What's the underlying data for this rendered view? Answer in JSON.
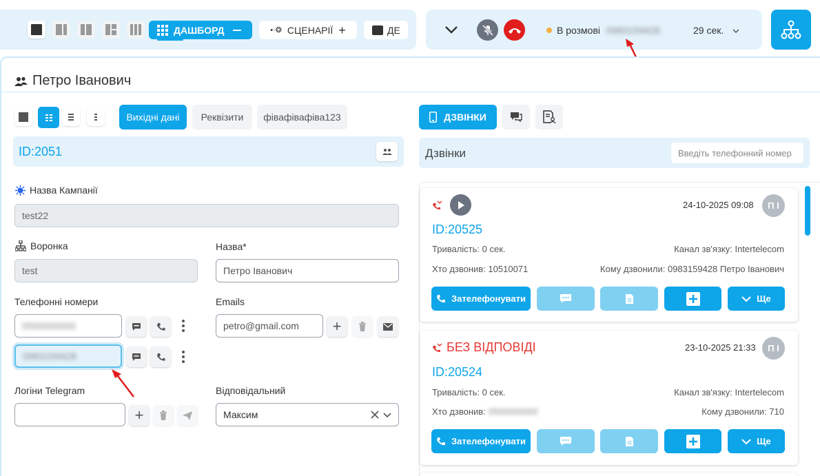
{
  "topbar": {
    "dashboard_label": "ДАШБОРД",
    "scenarios_label": "СЦЕНАРІЇ",
    "third_label": "ДЕ",
    "call_status": "В розмові",
    "call_number": "0983159428",
    "call_timer": "29 сек."
  },
  "contact": {
    "name": "Петро Іванович"
  },
  "left_tabs": {
    "tab1": "Вихідні дані",
    "tab2": "Реквізити",
    "tab3": "фівафівафіва123"
  },
  "form": {
    "id_label": "ID:2051",
    "campaign_label": "Назва Кампанії",
    "campaign_value": "test22",
    "funnel_label": "Воронка",
    "funnel_value": "test",
    "name_label": "Назва*",
    "name_value": "Петро Іванович",
    "phones_label": "Телефонні номери",
    "phone1": "0500000000",
    "phone2": "0983159428",
    "emails_label": "Emails",
    "email1": "petro@gmail.com",
    "telegram_label": "Логіни Telegram",
    "telegram_value": "",
    "responsible_label": "Відповідальний",
    "responsible_value": "Максим"
  },
  "right_tabs": {
    "calls_label": "ДЗВІНКИ"
  },
  "calls_panel": {
    "title": "Дзвінки",
    "search_placeholder": "Введіть телефонний номер"
  },
  "calls": [
    {
      "status": "",
      "datetime": "24-10-2025 09:08",
      "avatar": "П І",
      "id": "ID:20525",
      "duration": "Тривалість: 0 сек.",
      "channel": "Канал зв'язку: Intertelecom",
      "caller": "Хто дзвонив: 10510071",
      "callee": "Кому дзвонили: 0983159428 Петро Іванович",
      "call_btn": "Зателефонувати",
      "more_btn": "Ще"
    },
    {
      "status": "БЕЗ ВІДПОВІДІ",
      "datetime": "23-10-2025 21:33",
      "avatar": "П І",
      "id": "ID:20524",
      "duration": "Тривалість: 0 сек.",
      "channel": "Канал зв'язку: Intertelecom",
      "caller_label": "Хто дзвонив:",
      "caller_value": "0500000000",
      "callee": "Кому дзвонили: 710",
      "call_btn": "Зателефонувати",
      "more_btn": "Ще"
    }
  ],
  "colors": {
    "accent": "#0ea5e9",
    "panel": "#e3f2fb",
    "danger": "#e53935",
    "id_blue": "#0ea5e9"
  }
}
